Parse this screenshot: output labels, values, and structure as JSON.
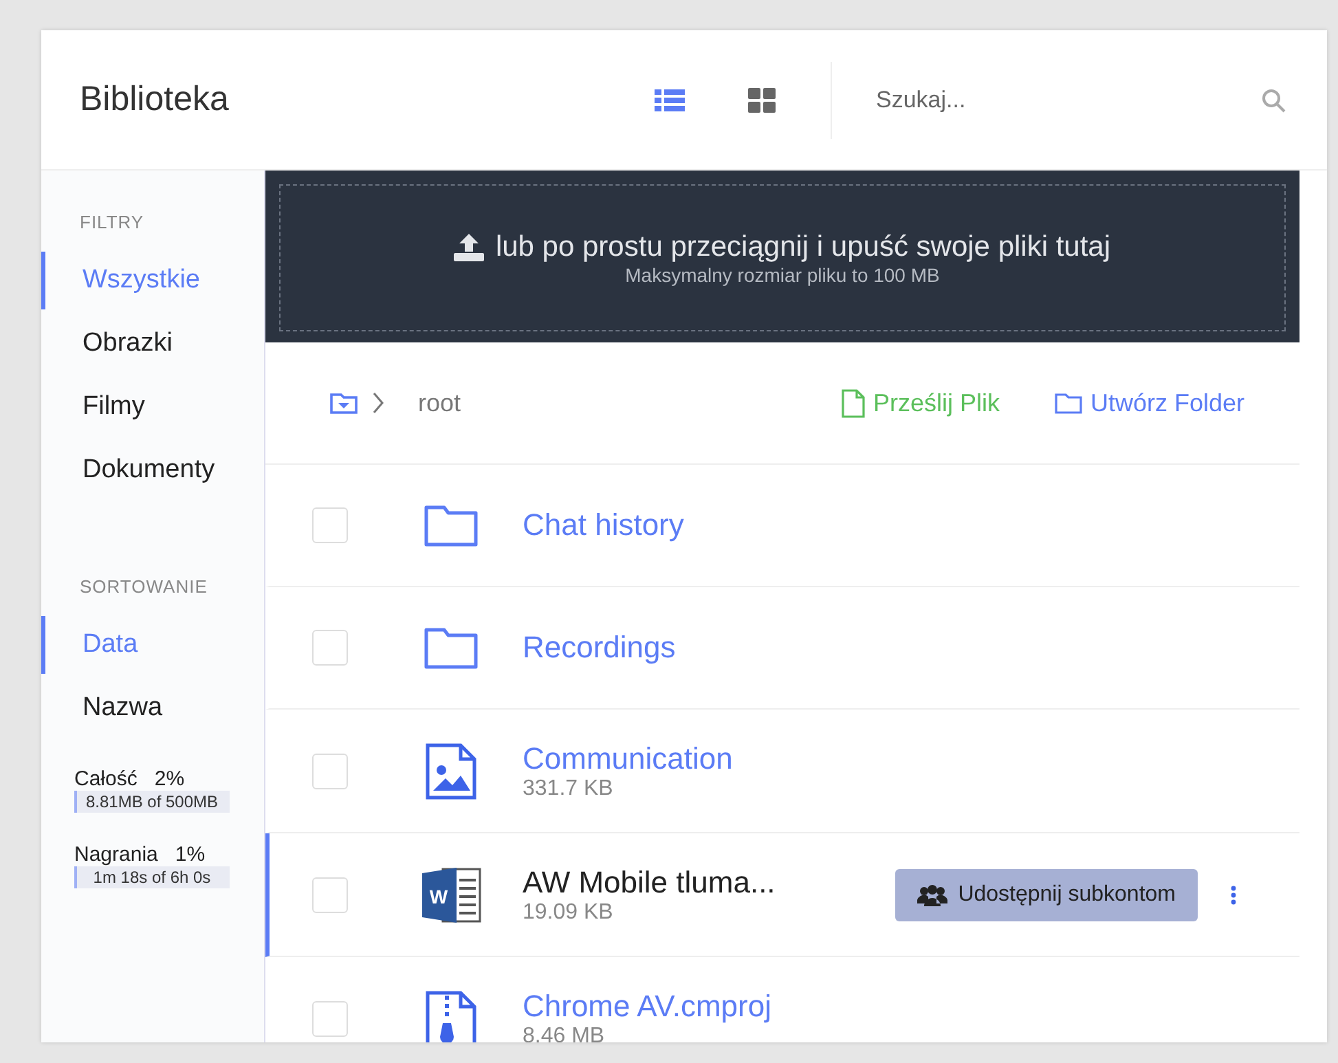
{
  "header": {
    "title": "Biblioteka",
    "views": [
      {
        "kind": "list",
        "selected": true
      },
      {
        "kind": "grid",
        "selected": false
      }
    ],
    "search": {
      "placeholder": "Szukaj..."
    }
  },
  "sidebar": {
    "sections": [
      {
        "heading": "FILTRY",
        "items": [
          {
            "label": "Wszystkie",
            "selected": true
          },
          {
            "label": "Obrazki",
            "selected": false
          },
          {
            "label": "Filmy",
            "selected": false
          },
          {
            "label": "Dokumenty",
            "selected": false
          }
        ]
      },
      {
        "heading": "SORTOWANIE",
        "items": [
          {
            "label": "Data",
            "selected": true
          },
          {
            "label": "Nazwa",
            "selected": false
          }
        ]
      }
    ],
    "usage": [
      {
        "label": "Całość",
        "percent": "2%",
        "reading": "8.81MB of 500MB",
        "level": 0.02
      },
      {
        "label": "Nagrania",
        "percent": "1%",
        "reading": "1m 18s of 6h 0s",
        "level": 0.01
      }
    ]
  },
  "dropzone": {
    "title": "lub po prostu przeciągnij i upuść swoje pliki tutaj",
    "subtitle": "Maksymalny rozmiar pliku to 100 MB"
  },
  "breadcrumb": {
    "path": "root",
    "actions": [
      {
        "kind": "upload",
        "label": "Prześlij Plik"
      },
      {
        "kind": "folder",
        "label": "Utwórz Folder"
      }
    ]
  },
  "files": [
    {
      "kind": "folder",
      "name": "Chat history",
      "checked": false,
      "hovered": false
    },
    {
      "kind": "folder",
      "name": "Recordings",
      "checked": false,
      "hovered": false
    },
    {
      "kind": "image",
      "name": "Communication",
      "size": "331.7 KB",
      "checked": false,
      "hovered": false
    },
    {
      "kind": "word",
      "icon_text": "W",
      "name": "AW Mobile tluma...",
      "size": "19.09 KB",
      "checked": false,
      "hovered": true,
      "share": "Udostępnij subkontom"
    },
    {
      "kind": "archive",
      "name": "Chrome AV.cmproj",
      "size": "8.46 MB",
      "checked": false,
      "hovered": false
    }
  ]
}
